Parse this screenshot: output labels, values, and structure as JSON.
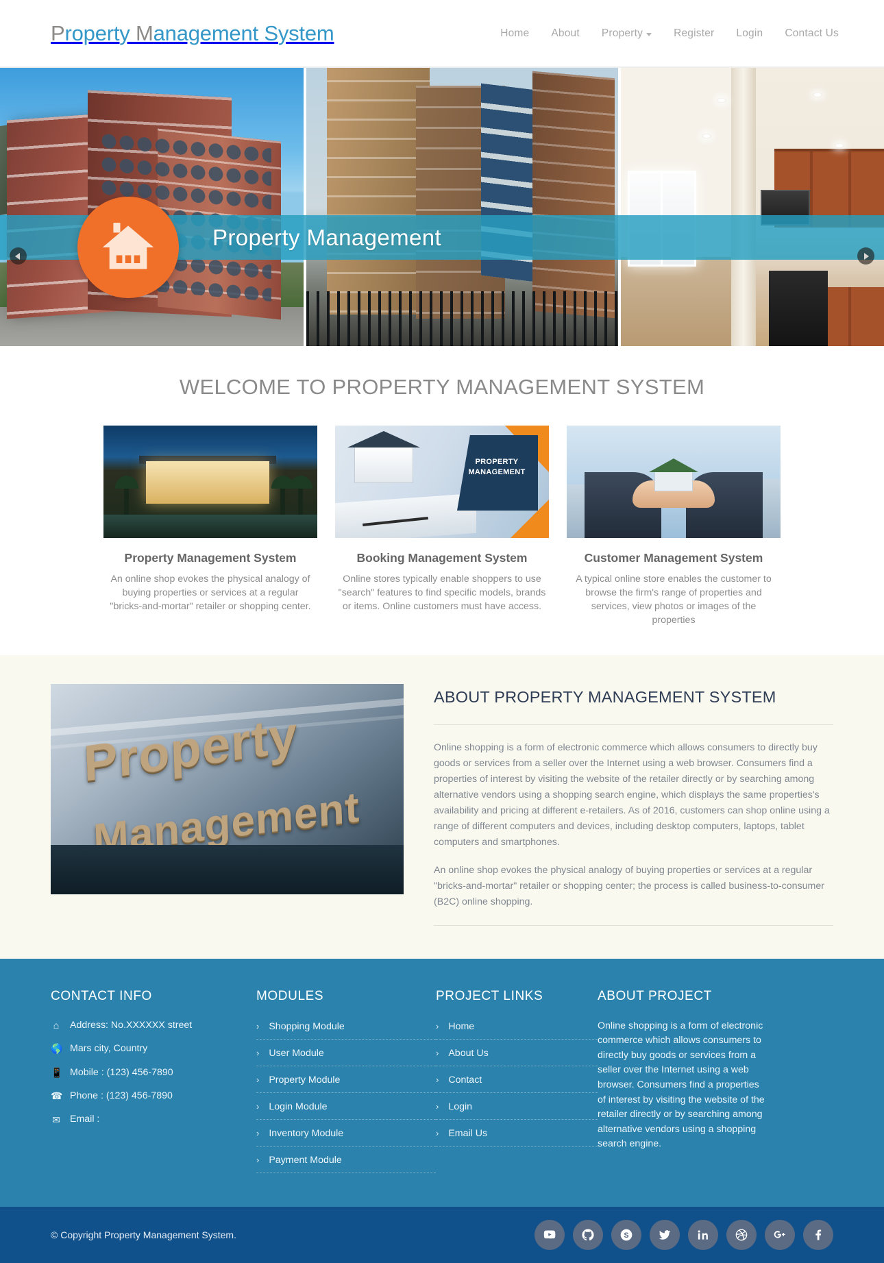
{
  "header": {
    "brand_part1": "P",
    "brand_part2": "roperty ",
    "brand_part3": "M",
    "brand_part4": "anagement System",
    "nav": [
      {
        "label": "Home",
        "has_caret": false
      },
      {
        "label": "About",
        "has_caret": false
      },
      {
        "label": "Property",
        "has_caret": true
      },
      {
        "label": "Register",
        "has_caret": false
      },
      {
        "label": "Login",
        "has_caret": false
      },
      {
        "label": "Contact Us",
        "has_caret": false
      }
    ]
  },
  "hero": {
    "caption": "Property Management",
    "prev_label": "Previous slide",
    "next_label": "Next slide"
  },
  "welcome": {
    "title": "WELCOME TO PROPERTY MANAGEMENT SYSTEM",
    "cards": [
      {
        "title": "Property Management System",
        "text": "An online shop evokes the physical analogy of buying properties or services at a regular \"bricks-and-mortar\" retailer or shopping center."
      },
      {
        "title": "Booking Management System",
        "text": "Online stores typically enable shoppers to use \"search\" features to find specific models, brands or items. Online customers must have access.",
        "overlay_label": "PROPERTY MANAGEMENT"
      },
      {
        "title": "Customer Management System",
        "text": "A typical online store enables the customer to browse the firm's range of properties and services, view photos or images of the properties"
      }
    ]
  },
  "about": {
    "image_word_1": "Property",
    "image_word_2": "Management",
    "title": "ABOUT PROPERTY MANAGEMENT SYSTEM",
    "paragraph1": "Online shopping is a form of electronic commerce which allows consumers to directly buy goods or services from a seller over the Internet using a web browser. Consumers find a properties of interest by visiting the website of the retailer directly or by searching among alternative vendors using a shopping search engine, which displays the same properties's availability and pricing at different e-retailers. As of 2016, customers can shop online using a range of different computers and devices, including desktop computers, laptops, tablet computers and smartphones.",
    "paragraph2": "An online shop evokes the physical analogy of buying properties or services at a regular \"bricks-and-mortar\" retailer or shopping center; the process is called business-to-consumer (B2C) online shopping."
  },
  "footer": {
    "contact": {
      "title": "CONTACT INFO",
      "items": [
        {
          "icon": "home-icon",
          "text": "Address: No.XXXXXX street"
        },
        {
          "icon": "globe-icon",
          "text": "Mars city, Country"
        },
        {
          "icon": "mobile-icon",
          "text": "Mobile : (123) 456-7890"
        },
        {
          "icon": "phone-icon",
          "text": "Phone : (123) 456-7890"
        },
        {
          "icon": "envelope-icon",
          "text": "Email :"
        }
      ]
    },
    "modules": {
      "title": "MODULES",
      "items": [
        "Shopping Module",
        "User Module",
        "Property Module",
        "Login Module",
        "Inventory Module",
        "Payment Module"
      ]
    },
    "project_links": {
      "title": "PROJECT LINKS",
      "items": [
        "Home",
        "About Us",
        "Contact",
        "Login",
        "Email Us"
      ]
    },
    "about_project": {
      "title": "ABOUT PROJECT",
      "text": "Online shopping is a form of electronic commerce which allows consumers to directly buy goods or services from a seller over the Internet using a web browser. Consumers find a properties of interest by visiting the website of the retailer directly or by searching among alternative vendors using a shopping search engine."
    },
    "copyright": "© Copyright Property Management System.",
    "socials": [
      {
        "name": "youtube-icon"
      },
      {
        "name": "github-icon"
      },
      {
        "name": "skype-icon"
      },
      {
        "name": "twitter-icon"
      },
      {
        "name": "linkedin-icon"
      },
      {
        "name": "dribbble-icon"
      },
      {
        "name": "googleplus-icon"
      },
      {
        "name": "facebook-icon"
      }
    ]
  },
  "colors": {
    "brand_blue": "#3598c9",
    "brand_gray": "#8d8b87",
    "hero_band": "#269fc1",
    "hero_logo": "#f0702a",
    "about_bg": "#faf9f0",
    "footer_bg": "#2b83ad",
    "copybar_bg": "#10518c",
    "social_bg": "#5b6b84",
    "about_title": "#2f3d55"
  }
}
